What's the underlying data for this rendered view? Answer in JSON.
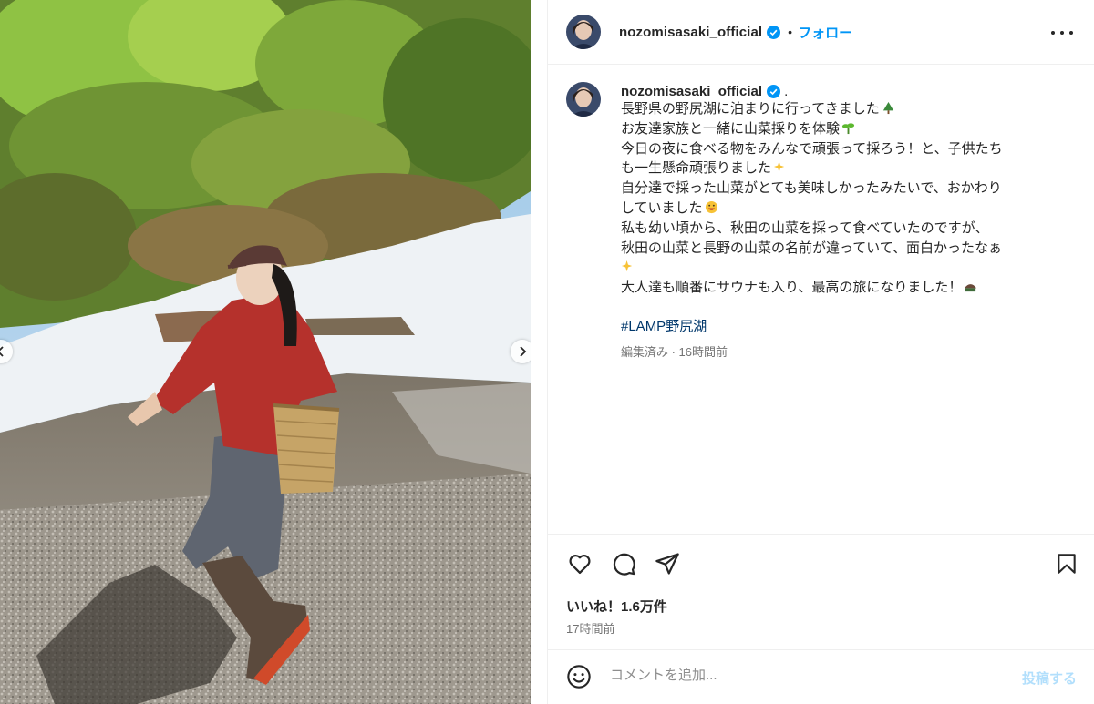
{
  "post": {
    "username": "nozomisasaki_official",
    "dot": "•",
    "follow_label": "フォロー",
    "caption": {
      "username": "nozomisasaki_official",
      "suffix": ".",
      "lines": [
        "長野県の野尻湖に泊まりに行ってきました",
        "お友達家族と一緒に山菜採りを体験",
        "今日の夜に食べる物をみんなで頑張って採ろう！と、子供たち",
        "も一生懸命頑張りました",
        "自分達で採った山菜がとても美味しかったみたいで、おかわり",
        "していました",
        "私も幼い頃から、秋田の山菜を採って食べていたのですが、",
        "秋田の山菜と長野の山菜の名前が違っていて、面白かったなぁ",
        "",
        "大人達も順番にサウナも入り、最高の旅になりました！"
      ],
      "hashtag": "#LAMP野尻湖",
      "meta": "編集済み · 16時間前"
    },
    "likes": "いいね！1.6万件",
    "posted": "17時間前",
    "comment_placeholder": "コメントを追加...",
    "post_button": "投稿する"
  },
  "icons": {
    "header_more": "more-horizontal-icon",
    "verified": "verified-badge-icon",
    "like": "heart-icon",
    "comment": "comment-icon",
    "share": "share-icon",
    "save": "bookmark-icon",
    "emoji": "smile-icon",
    "carousel_prev": "chevron-left-icon",
    "carousel_next": "chevron-right-icon"
  },
  "colors": {
    "accent": "#0095f6",
    "hashtag": "#00376b",
    "secondary_text": "#737373",
    "post_button_disabled": "#b2dffc"
  }
}
